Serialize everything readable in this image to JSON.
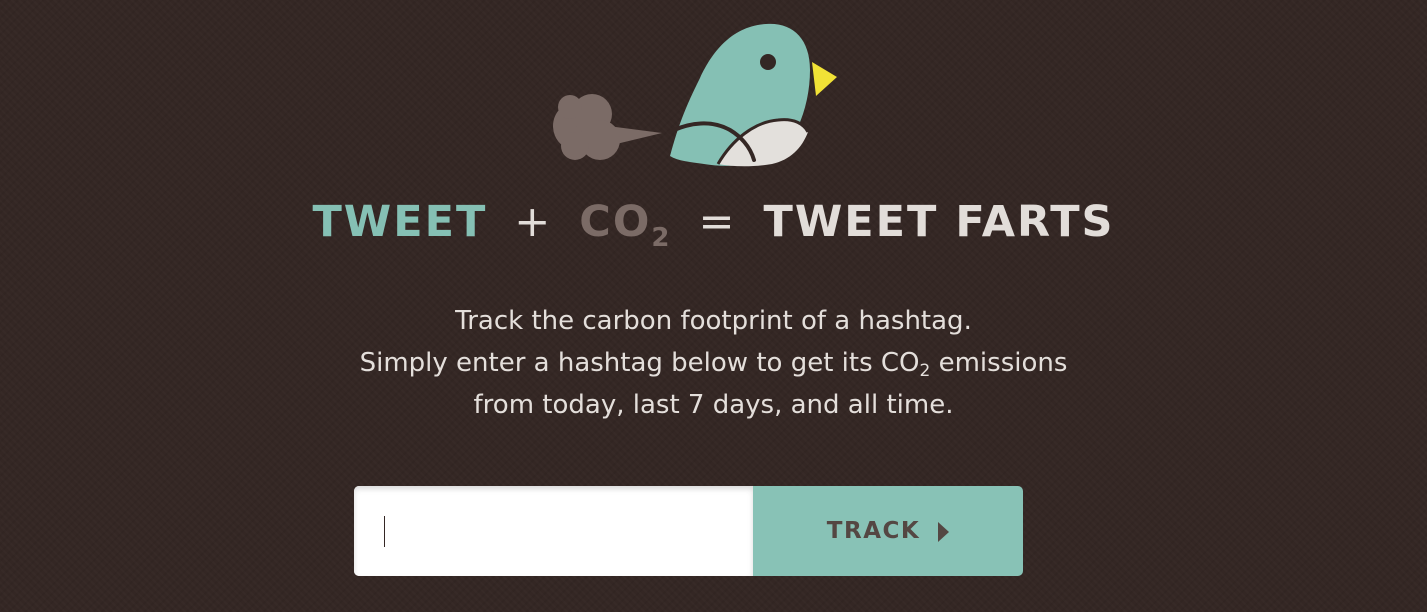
{
  "logo": {
    "icon": "farting-bird",
    "colors": {
      "bird": "#85c0b4",
      "belly": "#e3e0dc",
      "beak": "#f1e236",
      "cloud": "#7b6b66",
      "outline": "#342724"
    }
  },
  "headline": {
    "word1": "TWEET",
    "plus": "+",
    "co": "CO",
    "sub": "2",
    "equals": "=",
    "result": "TWEET FARTS"
  },
  "description": {
    "line1": "Track the carbon footprint of a hashtag.",
    "line2_pre": "Simply enter a hashtag below to get its CO",
    "line2_sub": "2",
    "line2_post": " emissions",
    "line3": "from today, last 7 days, and all time."
  },
  "form": {
    "input_value": "",
    "input_placeholder": "",
    "button_label": "TRACK",
    "button_icon": "caret-right-icon"
  },
  "colors": {
    "background": "#342724",
    "accent": "#88c2b6",
    "text": "#e4dfdb",
    "muted": "#7b6b66"
  }
}
